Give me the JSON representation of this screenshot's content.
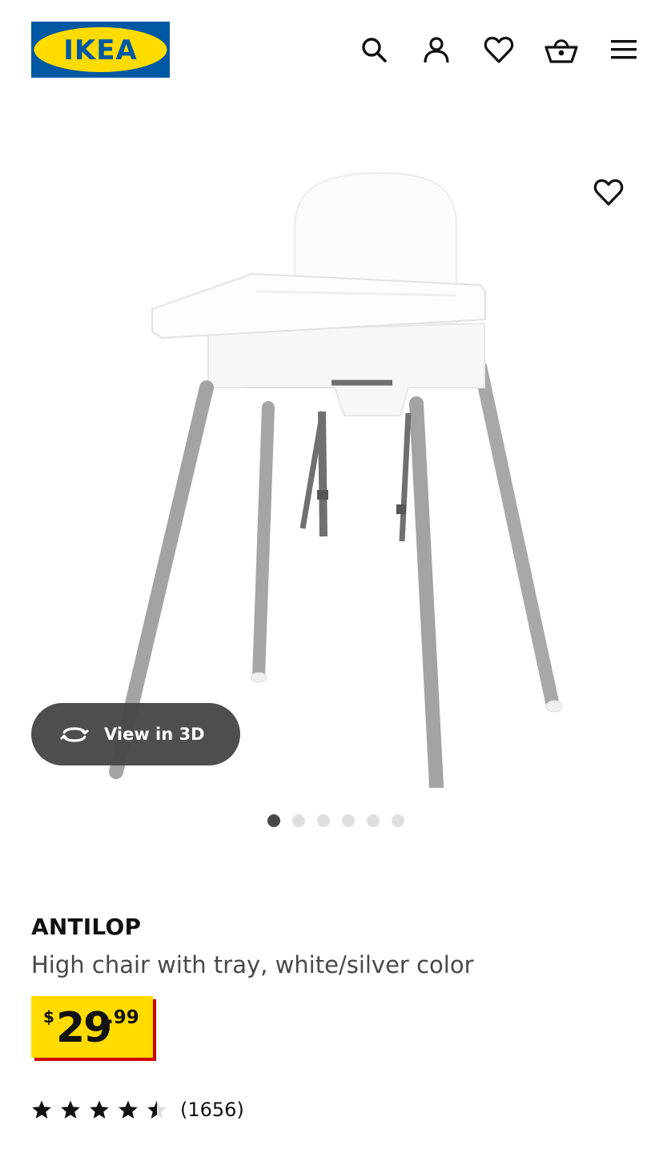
{
  "header": {
    "logo_text": "IKEA",
    "icons": [
      "search-icon",
      "account-icon",
      "heart-icon",
      "shopping-basket-icon",
      "hamburger-menu-icon"
    ]
  },
  "gallery": {
    "image_alt": "ANTILOP high chair with tray",
    "view_3d_label": "View in 3D",
    "slide_count": 6,
    "active_slide": 1
  },
  "product": {
    "name": "ANTILOP",
    "description": "High chair with tray, white/silver color",
    "price": {
      "currency": "$",
      "integer": "29",
      "decimal": ".99"
    },
    "rating": {
      "value": 4.5,
      "max": 5,
      "count_label": "(1656)"
    }
  },
  "colors": {
    "logo_blue": "#0058a3",
    "logo_yellow": "#ffdb00",
    "price_yellow": "#ffdb00",
    "price_shadow_red": "#cc0008",
    "button_dark": "#484848"
  }
}
